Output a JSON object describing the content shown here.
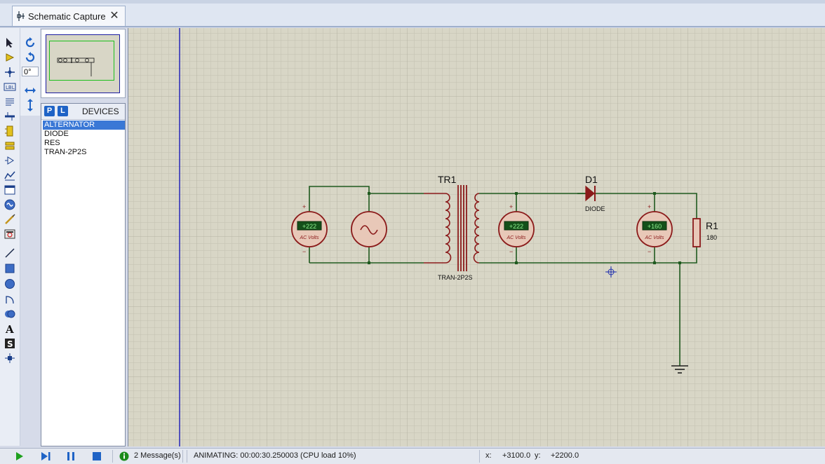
{
  "tab": {
    "label": "Schematic Capture",
    "close": "✕"
  },
  "toolbar": {
    "angle": "0°"
  },
  "devices": {
    "title": "DEVICES",
    "p_label": "P",
    "l_label": "L",
    "items": [
      "ALTERNATOR",
      "DIODE",
      "RES",
      "TRAN-2P2S"
    ],
    "selected": "ALTERNATOR"
  },
  "schematic": {
    "transformer": {
      "ref": "TR1",
      "type": "TRAN-2P2S"
    },
    "diode": {
      "ref": "D1",
      "type": "DIODE"
    },
    "resistor": {
      "ref": "R1",
      "value": "180"
    },
    "meters": [
      {
        "reading": "+222",
        "unit": "AC Volts",
        "plus": "+",
        "minus": "−"
      },
      {
        "reading": "+222",
        "unit": "AC Volts",
        "plus": "+",
        "minus": "−"
      },
      {
        "reading": "+160",
        "unit": "AC Volts",
        "plus": "+",
        "minus": "−"
      }
    ]
  },
  "status": {
    "messages": "2 Message(s)",
    "animating": "ANIMATING: 00:00:30.250003 (CPU load 10%)",
    "x_label": "x:",
    "x_value": "+3100.0",
    "y_label": "y:",
    "y_value": "+2200.0"
  },
  "colors": {
    "grid_bg": "#d8d6c6",
    "wire": "#1f5a1f",
    "component": "#8b1a1a",
    "meter_lcd": "#1d9a1d",
    "selection": "#3a78d6"
  }
}
